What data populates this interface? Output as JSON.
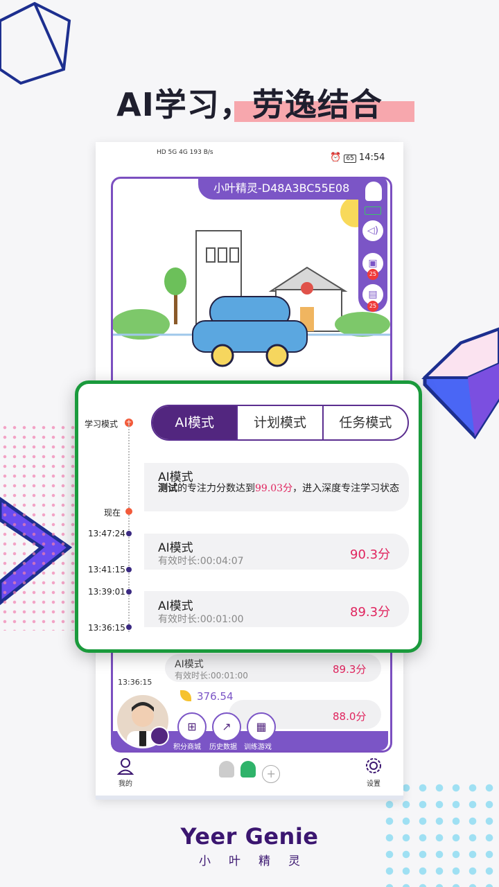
{
  "headline": "AI学习，劳逸结合",
  "status_bar": {
    "left": "HD 5G 4G 193 B/s",
    "time": "14:54",
    "battery": "65"
  },
  "device": {
    "name": "小叶精灵-D48A3BC55E08",
    "badge_count_1": "25",
    "badge_count_2": "25"
  },
  "panel": {
    "mode_label": "学习模式",
    "now_label": "现在",
    "tabs": [
      "AI模式",
      "计划模式",
      "任务模式"
    ],
    "message": {
      "title": "AI模式",
      "bold": "测试",
      "text_pre": "的专注力分数达到",
      "score": "99.03分",
      "text_post": "，进入深度专注学习状态"
    },
    "entries": [
      {
        "start": "13:47:24",
        "end": "13:41:15",
        "title": "AI模式",
        "duration": "有效时长:00:04:07",
        "score": "90.3分"
      },
      {
        "start": "13:39:01",
        "end": "13:36:15",
        "title": "AI模式",
        "duration": "有效时长:00:01:00",
        "score": "89.3分"
      }
    ]
  },
  "behind": {
    "row_title": "AI模式",
    "row_sub": "有效时长:00:01:00",
    "row_score": "89.3分",
    "row_time": "13:36:15",
    "points": "376.54",
    "score2": "88.0分",
    "actions": [
      "积分商城",
      "历史数据",
      "训练游戏"
    ]
  },
  "bottom_nav": {
    "me": "我的",
    "settings": "设置"
  },
  "brand": {
    "en": "Yeer Genie",
    "cn": "小叶精灵"
  },
  "colors": {
    "purple": "#7b55c6",
    "dark_purple": "#52267f",
    "green_border": "#1a9a3c",
    "score_pink": "#e0245e",
    "highlight_pink": "#f7a7ad"
  }
}
